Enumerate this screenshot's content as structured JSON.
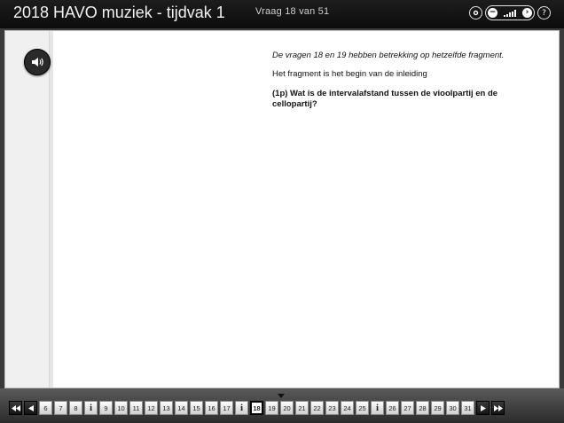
{
  "header": {
    "title": "2018 HAVO muziek - tijdvak 1",
    "question_counter": "Vraag 18 van 51",
    "icons": [
      "settings-icon",
      "volume-control",
      "help-icon"
    ],
    "help_glyph": "?"
  },
  "question": {
    "intro": "De vragen 18 en 19 hebben betrekking op hetzelfde fragment.",
    "fragment": "Het fragment is het begin van de inleiding",
    "prompt": "(1p) Wat is de intervalafstand tussen de vioolpartij en de cellopartij?"
  },
  "nav": {
    "items": [
      "6",
      "7",
      "8",
      "i",
      "9",
      "10",
      "11",
      "12",
      "13",
      "14",
      "15",
      "16",
      "17",
      "i",
      "18",
      "19",
      "20",
      "21",
      "22",
      "23",
      "24",
      "25",
      "i",
      "26",
      "27",
      "28",
      "29",
      "30",
      "31"
    ],
    "current": "18"
  }
}
